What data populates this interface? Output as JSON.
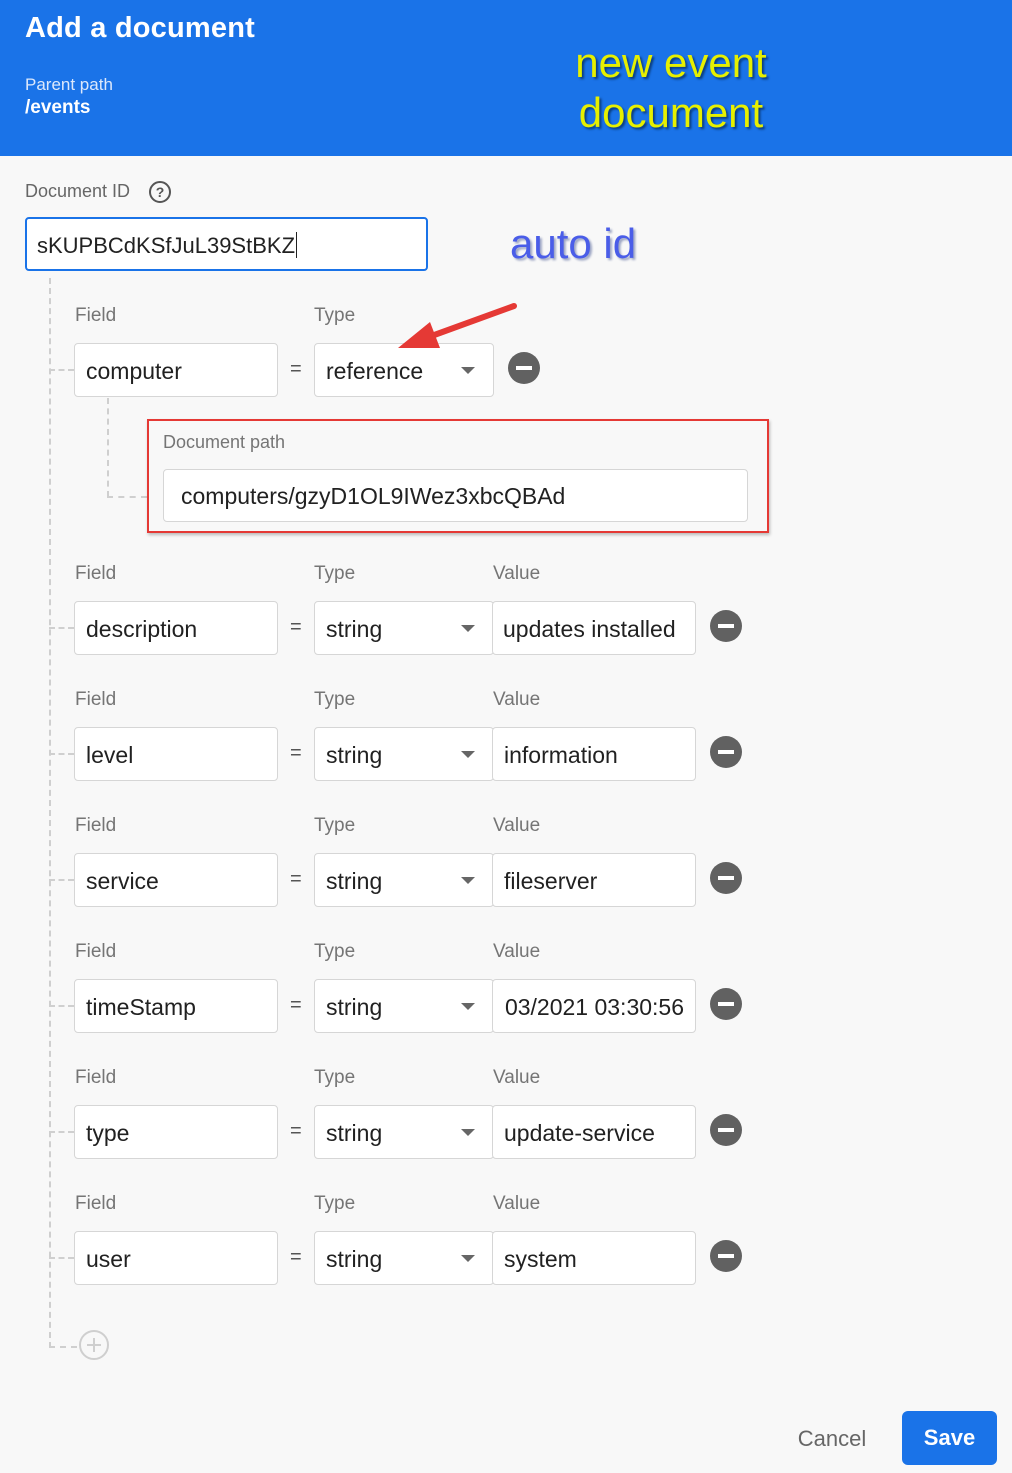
{
  "header": {
    "title": "Add a document",
    "parent_path_label": "Parent path",
    "parent_path_value": "/events",
    "annotation": "new event document"
  },
  "document_id": {
    "label": "Document ID",
    "value": "sKUPBCdKSfJuL39StBKZ",
    "annotation": "auto id"
  },
  "labels": {
    "field": "Field",
    "type": "Type",
    "value": "Value",
    "equals": "="
  },
  "reference_field": {
    "field": "computer",
    "type": "reference",
    "document_path_label": "Document path",
    "document_path": "computers/gzyD1OL9IWez3xbcQBAd"
  },
  "fields": [
    {
      "field": "description",
      "type": "string",
      "value": "updates installed"
    },
    {
      "field": "level",
      "type": "string",
      "value": "information"
    },
    {
      "field": "service",
      "type": "string",
      "value": "fileserver"
    },
    {
      "field": "timeStamp",
      "type": "string",
      "value": "03/2021 03:30:56"
    },
    {
      "field": "type",
      "type": "string",
      "value": "update-service"
    },
    {
      "field": "user",
      "type": "string",
      "value": "system"
    }
  ],
  "footer": {
    "cancel_label": "Cancel",
    "save_label": "Save"
  },
  "colors": {
    "header_bg": "#1a73e8",
    "annotation_yellow": "#e6f000",
    "annotation_blue": "#4a5de8",
    "highlight_red": "#e53935"
  }
}
